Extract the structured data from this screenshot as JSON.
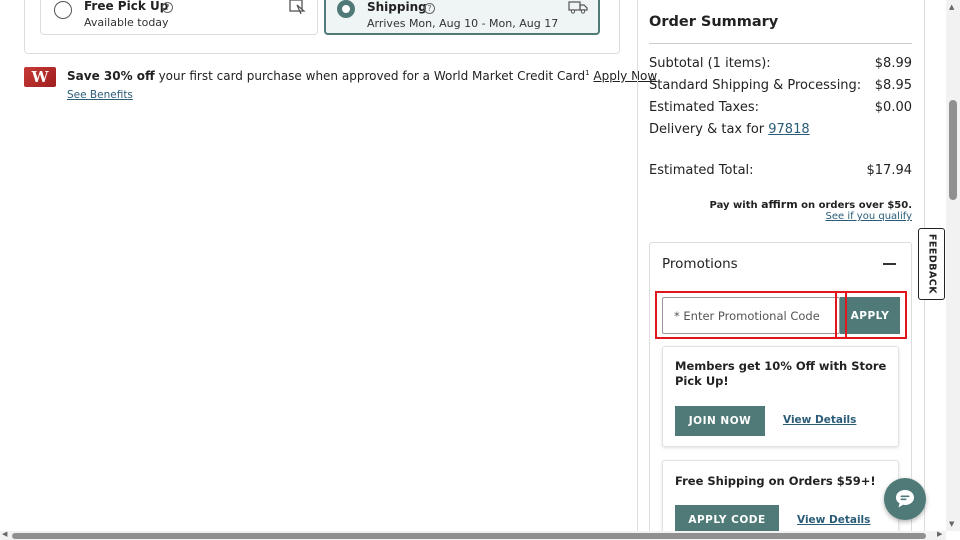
{
  "delivery": {
    "pickup": {
      "title": "Free Pick Up",
      "subtitle": "Available today"
    },
    "shipping": {
      "title": "Shipping",
      "subtitle": "Arrives Mon, Aug 10 - Mon, Aug 17"
    }
  },
  "banner": {
    "logo_letter": "W",
    "bold": "Save 30% off",
    "text": " your first card purchase when approved for a World Market Credit Card",
    "sup": "1",
    "apply_link": "Apply Now",
    "see_benefits": "See Benefits"
  },
  "summary": {
    "title": "Order Summary",
    "rows": [
      {
        "label": "Subtotal (1 items):",
        "value": "$8.99"
      },
      {
        "label": "Standard Shipping & Processing:",
        "value": "$8.95"
      },
      {
        "label": "Estimated Taxes:",
        "value": "$0.00"
      }
    ],
    "delivery_label": "Delivery & tax for ",
    "zip": "97818",
    "total_label": "Estimated Total:",
    "total_value": "$17.94",
    "affirm_pre": "Pay with ",
    "affirm_brand": "affirm",
    "affirm_post": " on orders over $50.",
    "affirm_link": "See if you qualify"
  },
  "promotions": {
    "title": "Promotions",
    "input_placeholder": "* Enter Promotional Code",
    "apply_label": "APPLY",
    "offers": [
      {
        "title": "Members get 10% Off with Store Pick Up!",
        "button": "JOIN NOW",
        "link": "View Details"
      },
      {
        "title": "Free Shipping on Orders $59+!",
        "button": "APPLY CODE",
        "link": "View Details"
      }
    ]
  },
  "feedback_label": "FEEDBACK",
  "colors": {
    "accent": "#4f7a78",
    "highlight": "#e0171c",
    "link": "#2a5c78"
  }
}
